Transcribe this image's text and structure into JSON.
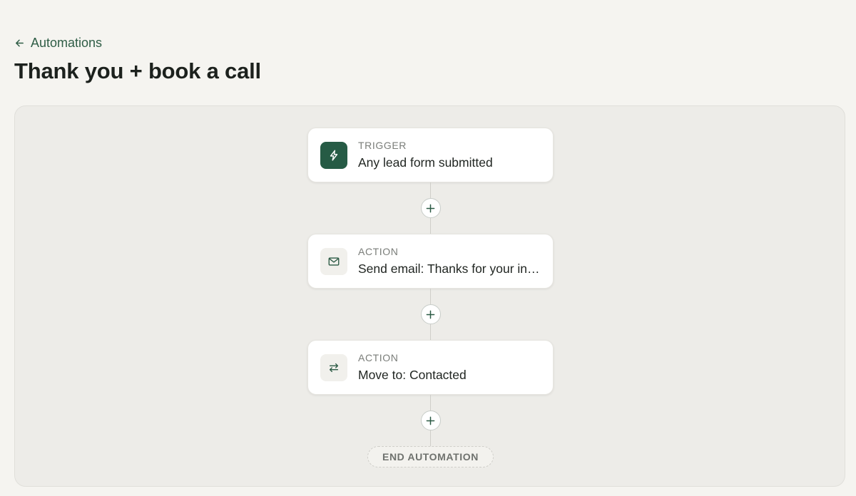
{
  "header": {
    "back_label": "Automations",
    "title": "Thank you + book a call"
  },
  "flow": {
    "steps": [
      {
        "kind": "TRIGGER",
        "label": "Any lead form submitted",
        "icon": "lightning-icon"
      },
      {
        "kind": "ACTION",
        "label": "Send email: Thanks for your interest",
        "icon": "mail-icon"
      },
      {
        "kind": "ACTION",
        "label": "Move to: Contacted",
        "icon": "swap-arrows-icon"
      }
    ],
    "add_step_label": "+",
    "end_label": "END AUTOMATION"
  },
  "colors": {
    "accent": "#265b45",
    "background": "#f5f4f0",
    "canvas": "#edece8"
  }
}
